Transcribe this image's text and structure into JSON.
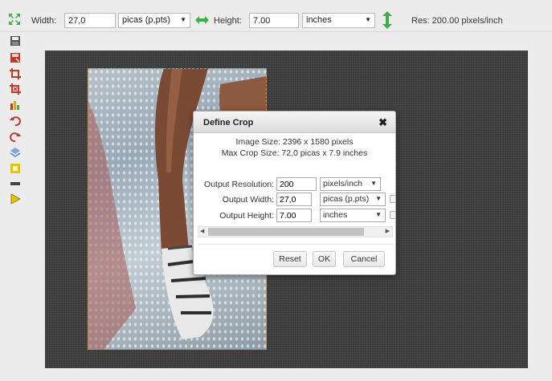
{
  "toolbar": {
    "width_label": "Width:",
    "width_value": "27,0",
    "width_unit": "picas (p,pts)",
    "height_label": "Height:",
    "height_value": "7.00",
    "height_unit": "inches",
    "resolution_text": "Res: 200.00 pixels/inch"
  },
  "tools": [
    "save-icon",
    "save-as-icon",
    "crop-icon",
    "crop-remove-icon",
    "chart-icon",
    "undo-icon",
    "redo-icon",
    "layers-icon",
    "frame-icon",
    "bar-icon",
    "play-icon"
  ],
  "dialog": {
    "title": "Define Crop",
    "image_size": "Image Size: 2396 x 1580 pixels",
    "max_crop_size": "Max Crop Size: 72,0 picas x 7.9 inches",
    "output_resolution_label": "Output Resolution:",
    "output_resolution_value": "200",
    "output_resolution_unit": "pixels/inch",
    "output_width_label": "Output Width:",
    "output_width_value": "27,0",
    "output_width_unit": "picas (p,pts)",
    "output_height_label": "Output Height:",
    "output_height_value": "7.00",
    "output_height_unit": "inches",
    "reset_label": "Reset",
    "ok_label": "OK",
    "cancel_label": "Cancel"
  },
  "colors": {
    "accent_green": "#3fae49",
    "crop_border": "#f28a1e",
    "tool_red": "#c0392b",
    "tool_yellow": "#e8c300"
  }
}
